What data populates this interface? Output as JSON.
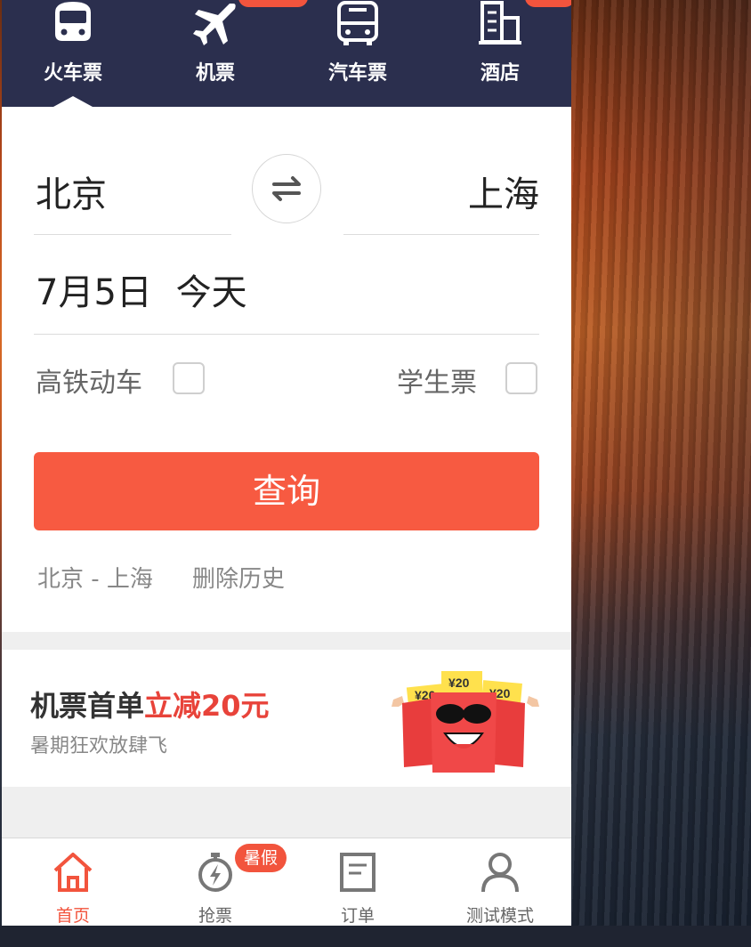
{
  "colors": {
    "accent": "#f75a41",
    "nav_bg": "#2b2f4e",
    "text": "#222222"
  },
  "topnav": {
    "items": [
      {
        "label": "火车票",
        "icon": "train-icon",
        "active": true
      },
      {
        "label": "机票",
        "icon": "plane-icon"
      },
      {
        "label": "汽车票",
        "icon": "bus-icon"
      },
      {
        "label": "酒店",
        "icon": "hotel-icon"
      }
    ]
  },
  "form": {
    "from_city": "北京",
    "to_city": "上海",
    "date": "7月5日",
    "day_label": "今天",
    "options": [
      {
        "label": "高铁动车",
        "checked": false
      },
      {
        "label": "学生票",
        "checked": false
      }
    ],
    "search_label": "查询",
    "history_route": "北京 - 上海",
    "clear_history": "删除历史"
  },
  "promo": {
    "title_prefix": "机票首单",
    "title_highlight": "立减20元",
    "subtitle": "暑期狂欢放肆飞",
    "coupon_labels": [
      "¥20",
      "¥20",
      "¥20"
    ]
  },
  "tabbar": {
    "items": [
      {
        "label": "首页",
        "icon": "home-icon",
        "active": true
      },
      {
        "label": "抢票",
        "icon": "stopwatch-icon"
      },
      {
        "label": "订单",
        "icon": "order-icon"
      },
      {
        "label": "测试模式",
        "icon": "user-icon"
      }
    ],
    "badge": "暑假"
  }
}
